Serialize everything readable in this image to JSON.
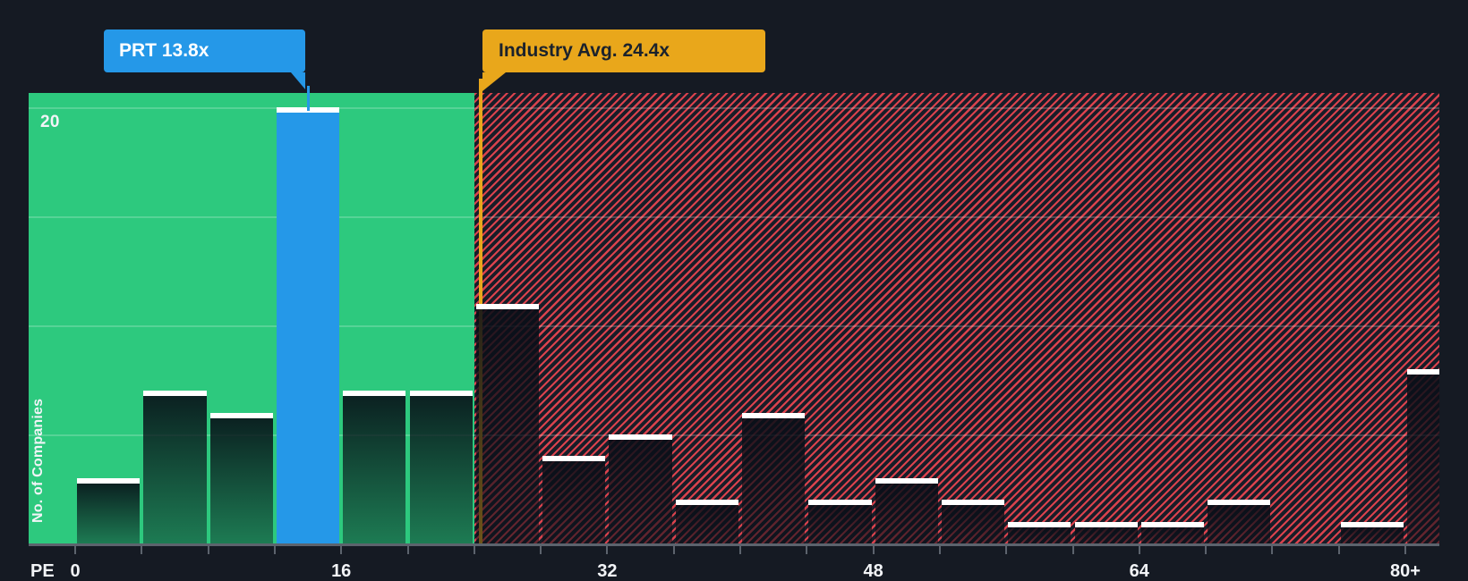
{
  "chart_data": {
    "type": "bar",
    "xlabel": "PE",
    "ylabel": "No. of Companies",
    "x_axis": {
      "tick_step_pe": 4,
      "min_pe": 0,
      "max_pe": 84,
      "labeled_ticks": [
        {
          "pe": 0,
          "label": "0"
        },
        {
          "pe": 16,
          "label": "16"
        },
        {
          "pe": 32,
          "label": "32"
        },
        {
          "pe": 48,
          "label": "48"
        },
        {
          "pe": 64,
          "label": "64"
        },
        {
          "pe": 80,
          "label": "80+"
        }
      ]
    },
    "y_axis": {
      "unit": "companies",
      "gridline_values": [
        5,
        10,
        15,
        20
      ],
      "top_gridline_label": "20",
      "ylim": [
        0,
        20.65
      ],
      "grid_on": true
    },
    "bins": [
      {
        "range": "0-4",
        "start": 0,
        "end": 4,
        "count": 3
      },
      {
        "range": "4-8",
        "start": 4,
        "end": 8,
        "count": 7
      },
      {
        "range": "8-12",
        "start": 8,
        "end": 12,
        "count": 6
      },
      {
        "range": "12-16",
        "start": 12,
        "end": 16,
        "count": 20,
        "company": true
      },
      {
        "range": "16-20",
        "start": 16,
        "end": 20,
        "count": 7
      },
      {
        "range": "20-24",
        "start": 20,
        "end": 24,
        "count": 7
      },
      {
        "range": "24-28",
        "start": 24,
        "end": 28,
        "count": 11
      },
      {
        "range": "28-32",
        "start": 28,
        "end": 32,
        "count": 4
      },
      {
        "range": "32-36",
        "start": 32,
        "end": 36,
        "count": 5
      },
      {
        "range": "36-40",
        "start": 36,
        "end": 40,
        "count": 2
      },
      {
        "range": "40-44",
        "start": 40,
        "end": 44,
        "count": 6
      },
      {
        "range": "44-48",
        "start": 44,
        "end": 48,
        "count": 2
      },
      {
        "range": "48-52",
        "start": 48,
        "end": 52,
        "count": 3
      },
      {
        "range": "52-56",
        "start": 52,
        "end": 56,
        "count": 2
      },
      {
        "range": "56-60",
        "start": 56,
        "end": 60,
        "count": 1
      },
      {
        "range": "60-64",
        "start": 60,
        "end": 64,
        "count": 1
      },
      {
        "range": "64-68",
        "start": 64,
        "end": 68,
        "count": 1
      },
      {
        "range": "68-72",
        "start": 68,
        "end": 72,
        "count": 2
      },
      {
        "range": "72-76",
        "start": 72,
        "end": 76,
        "count": 0
      },
      {
        "range": "76-80",
        "start": 76,
        "end": 80,
        "count": 1
      },
      {
        "range": "80+",
        "start": 80,
        "end": 84,
        "count": 8,
        "half_width": true
      }
    ],
    "annotations": {
      "company": {
        "label": "PRT 13.8x",
        "pe": 13.8
      },
      "industry": {
        "label": "Industry Avg. 24.4x",
        "pe": 24.4
      }
    },
    "zones": {
      "below_avg_green_end_pe": 24,
      "hatch_start_pe": 24
    }
  },
  "colors": {
    "background": "#151a23",
    "below_avg_green": "#2dc97e",
    "company_blue": "#2598e8",
    "industry_yellow": "#e9a71b",
    "hatch_red": "#ea4650",
    "hatch_background": "#181d28",
    "bar_cap_white": "#ffffff",
    "axis_gray": "#5c636d",
    "text_light": "#f2f4f7",
    "callout_dark_text": "#1b222c"
  }
}
